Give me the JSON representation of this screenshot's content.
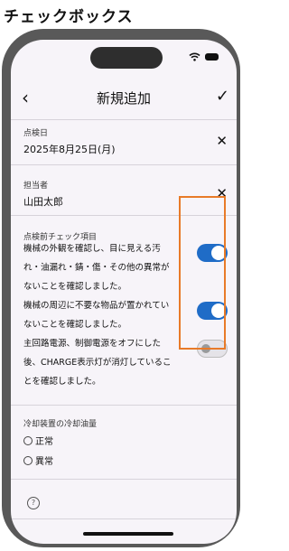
{
  "caption": "チェックボックス",
  "navbar": {
    "back": "‹",
    "title": "新規追加",
    "confirm": "✓"
  },
  "fields": [
    {
      "label": "点検日",
      "value": "2025年8月25日(月)",
      "clear": "✕"
    },
    {
      "label": "担当者",
      "value": "山田太郎",
      "clear": "✕"
    }
  ],
  "checklist": {
    "label": "点検前チェック項目",
    "lines": [
      "機械の外観を確認し、目に見える汚",
      "れ・油漏れ・錆・傷・その他の異常が",
      "ないことを確認しました。",
      "機械の周辺に不要な物品が置かれてい",
      "ないことを確認しました。",
      "主回路電源、制御電源をオフにした",
      "後、CHARGE表示灯が消灯しているこ",
      "とを確認しました。"
    ],
    "toggles": [
      {
        "state": "on"
      },
      {
        "state": "on"
      },
      {
        "state": "off"
      }
    ]
  },
  "cooling": {
    "label": "冷却装置の冷却油量",
    "options": [
      "正常",
      "異常"
    ]
  },
  "help_icon": "?",
  "colors": {
    "accent": "#1f6cc7",
    "highlight": "#e87a28"
  }
}
